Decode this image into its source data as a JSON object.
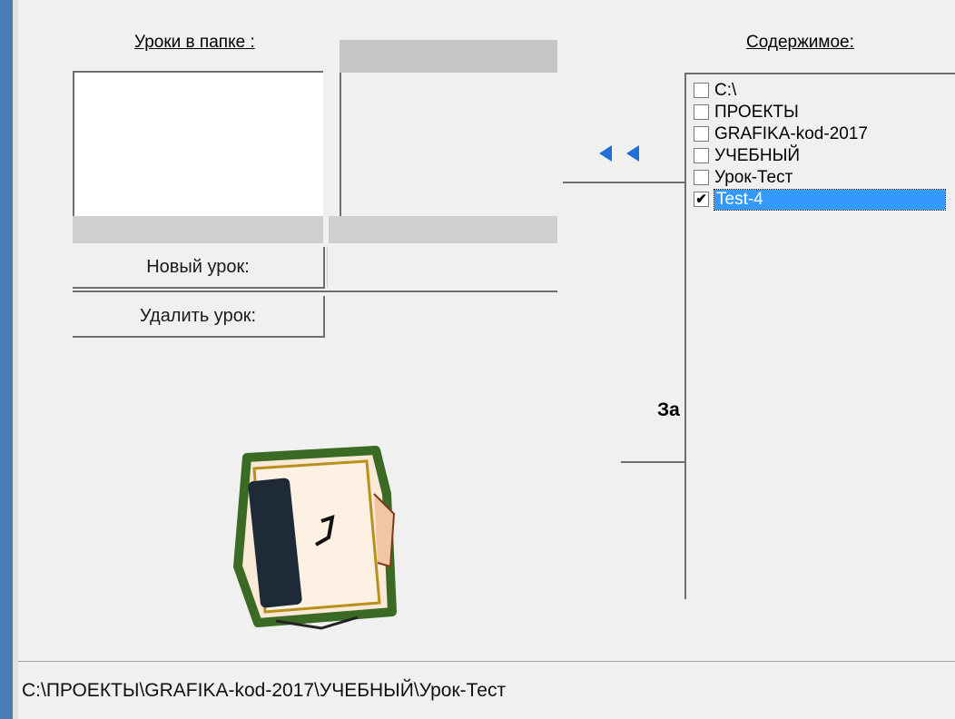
{
  "lessons_panel": {
    "header": "Уроки в папке :",
    "new_lesson_button": "Новый урок:",
    "delete_lesson_button": "Удалить урок:"
  },
  "contents_panel": {
    "header": "Содержимое:",
    "items": [
      {
        "label": "C:\\",
        "checked": false,
        "selected": false
      },
      {
        "label": "ПРОЕКТЫ",
        "checked": false,
        "selected": false
      },
      {
        "label": "GRAFIKA-kod-2017",
        "checked": false,
        "selected": false
      },
      {
        "label": "УЧЕБНЫЙ",
        "checked": false,
        "selected": false
      },
      {
        "label": "Урок-Тест",
        "checked": false,
        "selected": false
      },
      {
        "label": "Test-4",
        "checked": true,
        "selected": true
      }
    ]
  },
  "arrow_button": {
    "icon": "double-left-triangle-icon",
    "color": "#1f6fd6"
  },
  "save_label": "За",
  "status_bar": {
    "path": "C:\\ПРОЕКТЫ\\GRAFIKA-kod-2017\\УЧЕБНЫЙ\\Урок-Тест"
  },
  "colors": {
    "left_border": "#4a7bb5",
    "selection": "#3399ff"
  }
}
